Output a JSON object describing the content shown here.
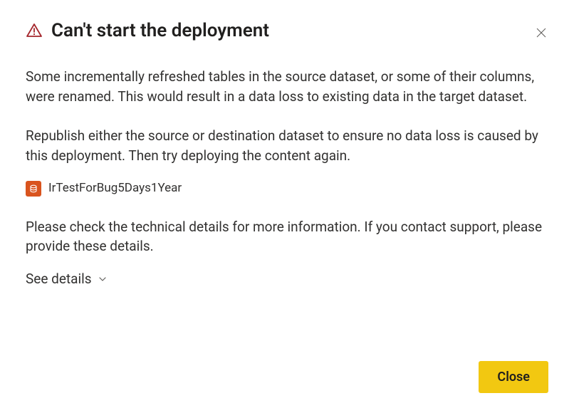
{
  "dialog": {
    "title": "Can't start the deployment",
    "paragraph1": "Some incrementally refreshed tables in the source dataset, or some of their columns, were renamed. This would result in a data loss to existing data in the target dataset.",
    "paragraph2": "Republish either the source or destination dataset to ensure no data loss is caused by this deployment. Then try deploying the content again.",
    "dataset_name": "IrTestForBug5Days1Year",
    "paragraph3": "Please check the technical details for more information. If you contact support, please provide these details.",
    "see_details_label": "See details",
    "close_button_label": "Close"
  },
  "colors": {
    "warning": "#a4262c",
    "dataset_icon_bg": "#d9541e",
    "primary_button_bg": "#f2c811"
  }
}
